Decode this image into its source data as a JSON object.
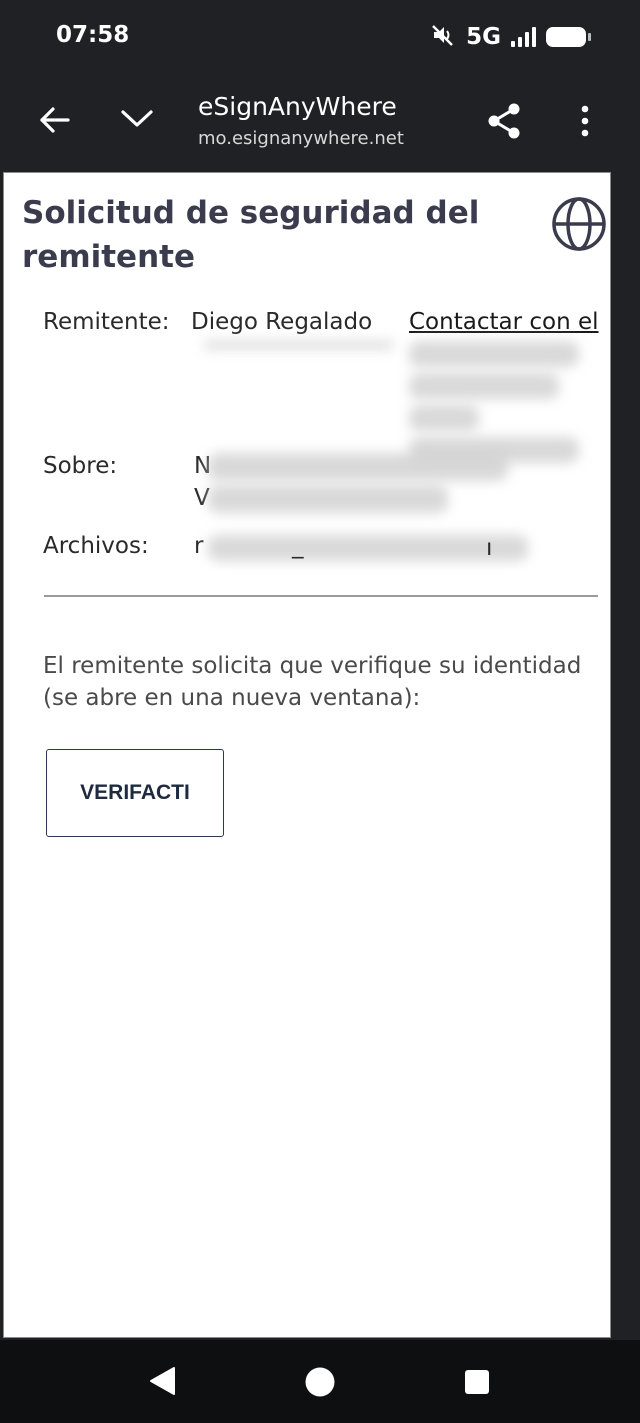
{
  "status_bar": {
    "time": "07:58",
    "network": "5G",
    "icons": [
      "mute-icon",
      "signal-icon",
      "battery-icon"
    ]
  },
  "toolbar": {
    "title": "eSignAnyWhere",
    "url": "mo.esignanywhere.net",
    "icons": [
      "back-arrow-icon",
      "chevron-down-icon",
      "share-icon",
      "more-vert-icon"
    ]
  },
  "page": {
    "title": "Solicitud de seguridad del remitente",
    "sender_label": "Remitente:",
    "sender_name": "Diego Regalado",
    "contact_link": "Contactar con el",
    "envelope_label": "Sobre:",
    "envelope_value_start": "N",
    "envelope_value_start_2": "V",
    "files_label": "Archivos:",
    "files_value_start": "r",
    "files_value_sep": "_",
    "files_value_mid": "ı",
    "message": "El remitente solicita que verifique su identidad (se abre en una nueva ventana):",
    "verify_button": "VERIFACTI"
  },
  "colors": {
    "system_bar": "#1f2124",
    "title_text": "#3a3b4c",
    "button_border": "#2b3a52",
    "nav_bar": "#0e0f10"
  },
  "nav_bar": {
    "items": [
      "back-triangle-icon",
      "home-circle-icon",
      "recents-square-icon"
    ]
  }
}
